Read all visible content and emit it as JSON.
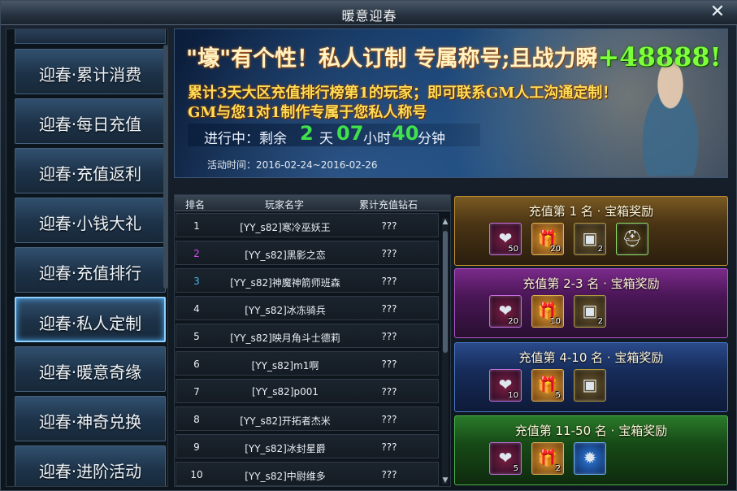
{
  "window": {
    "title": "暖意迎春",
    "close_icon": "close-icon"
  },
  "menu": {
    "items": [
      {
        "label": "迎春·累计消费",
        "active": false
      },
      {
        "label": "迎春·每日充值",
        "active": false
      },
      {
        "label": "迎春·充值返利",
        "active": false
      },
      {
        "label": "迎春·小钱大礼",
        "active": false
      },
      {
        "label": "迎春·充值排行",
        "active": false
      },
      {
        "label": "迎春·私人定制",
        "active": true
      },
      {
        "label": "迎春·暖意奇缘",
        "active": false
      },
      {
        "label": "迎春·神奇兑换",
        "active": false
      },
      {
        "label": "迎春·进阶活动",
        "active": false
      }
    ]
  },
  "banner": {
    "headline_a": "\"壕\"有个性！私人订制 专属称号;且战力瞬",
    "headline_power": "+48888!",
    "desc_line1": "累计3天大区充值排行榜第1的玩家；即可联系GM人工沟通定制！",
    "desc_line2": "GM与您1对1制作专属于您私人称号",
    "countdown": {
      "prefix": "进行中：剩余",
      "days": "2",
      "days_unit": "天",
      "hours": "07",
      "hours_unit": "小时",
      "minutes": "40",
      "minutes_unit": "分钟"
    },
    "period": "活动时间：2016-02-24~2016-02-26"
  },
  "ranking": {
    "headers": {
      "rank": "排名",
      "name": "玩家名字",
      "diamonds": "累计充值钻石"
    },
    "rows": [
      {
        "rank": "1",
        "name": "[YY_s82]寒冷巫妖王",
        "diamonds": "???"
      },
      {
        "rank": "2",
        "name": "[YY_s82]黑影之恋",
        "diamonds": "???"
      },
      {
        "rank": "3",
        "name": "[YY_s82]神魔神箭师班森",
        "diamonds": "???"
      },
      {
        "rank": "4",
        "name": "[YY_s82]冰冻骑兵",
        "diamonds": "???"
      },
      {
        "rank": "5",
        "name": "[YY_s82]映月角斗士德莉",
        "diamonds": "???"
      },
      {
        "rank": "6",
        "name": "[YY_s82]m1啊",
        "diamonds": "???"
      },
      {
        "rank": "7",
        "name": "[YY_s82]p001",
        "diamonds": "???"
      },
      {
        "rank": "8",
        "name": "[YY_s82]开拓者杰米",
        "diamonds": "???"
      },
      {
        "rank": "9",
        "name": "[YY_s82]冰封星爵",
        "diamonds": "???"
      },
      {
        "rank": "10",
        "name": "[YY_s82]中尉维多",
        "diamonds": "???"
      }
    ]
  },
  "rewards": [
    {
      "title": "充值第 1 名 · 宝箱奖励",
      "theme": "gold",
      "items": [
        {
          "icon": "heart-potion-icon",
          "count": "50"
        },
        {
          "icon": "gift-box-icon",
          "count": "20"
        },
        {
          "icon": "treasure-chest-icon",
          "count": "2"
        },
        {
          "icon": "helmet-icon",
          "count": ""
        }
      ]
    },
    {
      "title": "充值第 2-3 名 · 宝箱奖励",
      "theme": "purple",
      "items": [
        {
          "icon": "heart-potion-icon",
          "count": "20"
        },
        {
          "icon": "gift-box-icon",
          "count": "10"
        },
        {
          "icon": "treasure-chest-icon",
          "count": "2"
        }
      ]
    },
    {
      "title": "充值第 4-10 名 · 宝箱奖励",
      "theme": "blue",
      "items": [
        {
          "icon": "heart-potion-icon",
          "count": "10"
        },
        {
          "icon": "gift-box-icon",
          "count": "5"
        },
        {
          "icon": "treasure-chest-icon",
          "count": ""
        }
      ]
    },
    {
      "title": "充值第 11-50 名 · 宝箱奖励",
      "theme": "green",
      "items": [
        {
          "icon": "heart-potion-icon",
          "count": "5"
        },
        {
          "icon": "gift-box-icon",
          "count": "2"
        },
        {
          "icon": "gem-icon",
          "count": ""
        }
      ]
    }
  ]
}
